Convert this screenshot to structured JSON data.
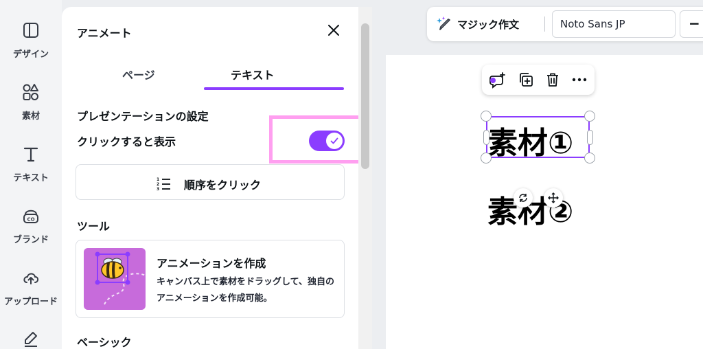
{
  "sidebar": {
    "items": [
      {
        "label": "デザイン",
        "icon": "layout-icon"
      },
      {
        "label": "素材",
        "icon": "elements-icon"
      },
      {
        "label": "テキスト",
        "icon": "text-icon"
      },
      {
        "label": "ブランド",
        "icon": "brand-icon"
      },
      {
        "label": "アップロード",
        "icon": "upload-icon"
      }
    ]
  },
  "panel": {
    "title": "アニメート",
    "tabs": [
      {
        "label": "ページ",
        "active": false
      },
      {
        "label": "テキスト",
        "active": true
      }
    ],
    "presentation": {
      "heading": "プレゼンテーションの設定",
      "toggle_label": "クリックすると表示",
      "toggle_on": true,
      "order_button": "順序をクリック"
    },
    "tools": {
      "heading": "ツール",
      "card_title": "アニメーションを作成",
      "card_desc": "キャンバス上で素材をドラッグして、独自のアニメーションを作成可能。"
    },
    "basic_heading": "ベーシック"
  },
  "toolbar": {
    "magic_write": "マジック作文",
    "font": "Noto Sans JP",
    "minus": "−"
  },
  "canvas": {
    "text1": "素材①",
    "text2": "素材②"
  },
  "colors": {
    "accent": "#8b3dff",
    "highlight": "#ff9ff0",
    "thumb_bg": "#c76bdb"
  }
}
